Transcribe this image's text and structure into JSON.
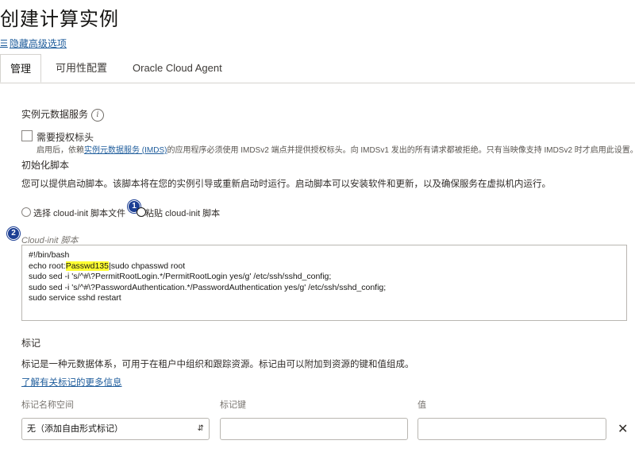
{
  "page": {
    "title": "创建计算实例"
  },
  "advanced": {
    "toggle_icon": "list-icon",
    "label": "隐藏高级选项"
  },
  "tabs": [
    {
      "label": "管理"
    },
    {
      "label": "可用性配置"
    },
    {
      "label": "Oracle Cloud Agent"
    }
  ],
  "imds": {
    "heading": "实例元数据服务",
    "info_icon": "i",
    "checkbox_label": "需要授权标头",
    "help_before": "启用后，依赖",
    "help_link": "实例元数据服务 (IMDS)",
    "help_after": "的应用程序必须使用 IMDSv2 端点并提供授权标头。向 IMDSv1 发出的所有请求都被拒绝。只有当映像支持 IMDSv2 时才启用此设置。"
  },
  "init": {
    "heading": "初始化脚本",
    "description": "您可以提供启动脚本。该脚本将在您的实例引导或重新启动时运行。启动脚本可以安装软件和更新，以及确保服务在虚拟机内运行。",
    "option_file": "选择 cloud-init 脚本文件",
    "option_paste": "粘贴 cloud-init 脚本",
    "badge1": "1",
    "badge2": "2",
    "script_label": "Cloud-init 脚本",
    "script_lines": {
      "l1": "#!/bin/bash",
      "l2_pre": "echo root:",
      "l2_hl": "Passwd135",
      "l2_post": "|sudo chpasswd root",
      "l3": "sudo sed -i 's/^#\\?PermitRootLogin.*/PermitRootLogin yes/g' /etc/ssh/sshd_config;",
      "l4": "sudo sed -i 's/^#\\?PasswordAuthentication.*/PasswordAuthentication yes/g' /etc/ssh/sshd_config;",
      "l5": "sudo service sshd restart"
    }
  },
  "tags": {
    "heading": "标记",
    "description": "标记是一种元数据体系，可用于在租户中组织和跟踪资源。标记由可以附加到资源的键和值组成。",
    "learn_more": "了解有关标记的更多信息",
    "col_namespace": "标记名称空间",
    "col_key": "标记键",
    "col_value": "值",
    "namespace_selected": "无（添加自由形式标记）",
    "chevron": "⌃⌄",
    "remove": "✕"
  }
}
